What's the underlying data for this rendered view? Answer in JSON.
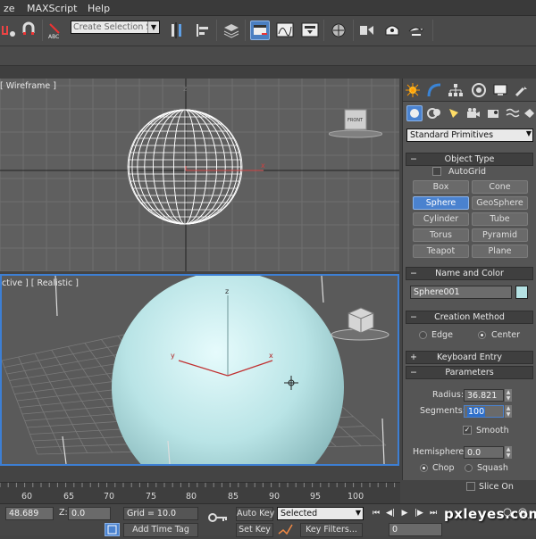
{
  "menubar": {
    "items": [
      "ze",
      "MAXScript",
      "Help"
    ]
  },
  "toolbar": {
    "selection_set_placeholder": "Create Selection Se",
    "abc_icon_label": "ABC"
  },
  "viewports": {
    "top_label": "[ Wireframe ]",
    "persp_label": "ctive ] [ Realistic ]",
    "viewcube_label": "FRONT",
    "axis_x": "x",
    "axis_y": "y",
    "axis_z": "z"
  },
  "command_panel": {
    "tabs": [
      "create-tab",
      "modify-tab",
      "hierarchy-tab",
      "motion-tab",
      "display-tab",
      "utilities-tab"
    ],
    "category": "Standard Primitives",
    "object_type": {
      "header": "Object Type",
      "autogrid_label": "AutoGrid",
      "buttons": [
        "Box",
        "Cone",
        "Sphere",
        "GeoSphere",
        "Cylinder",
        "Tube",
        "Torus",
        "Pyramid",
        "Teapot",
        "Plane"
      ],
      "active": "Sphere"
    },
    "name_and_color": {
      "header": "Name and Color",
      "name_value": "Sphere001",
      "color": "#b5e2e4"
    },
    "creation_method": {
      "header": "Creation Method",
      "options": [
        "Edge",
        "Center"
      ],
      "selected": "Center"
    },
    "keyboard_entry": {
      "header": "Keyboard Entry"
    },
    "parameters": {
      "header": "Parameters",
      "radius_label": "Radius:",
      "radius_value": "36.821",
      "segments_label": "Segments:",
      "segments_value": "100",
      "smooth_label": "Smooth",
      "hemisphere_label": "Hemisphere:",
      "hemisphere_value": "0.0",
      "chop_label": "Chop",
      "squash_label": "Squash",
      "slice_on_label": "Slice On"
    }
  },
  "timeline": {
    "ticks": [
      "60",
      "65",
      "70",
      "75",
      "80",
      "85",
      "90",
      "95",
      "100"
    ]
  },
  "statusbar": {
    "y_value": "48.689",
    "z_label": "Z:",
    "z_value": "0.0",
    "grid_label": "Grid = 10.0",
    "add_time_tag": "Add Time Tag",
    "auto_key": "Auto Key",
    "set_key": "Set Key",
    "selected_option": "Selected",
    "key_filters": "Key Filters...",
    "frame_value": "0"
  },
  "watermark": "pxleyes.com",
  "colors": {
    "accent": "#4a82cf",
    "sphere": "#b5e2e4",
    "viewport_border": "#3d7fd4"
  }
}
